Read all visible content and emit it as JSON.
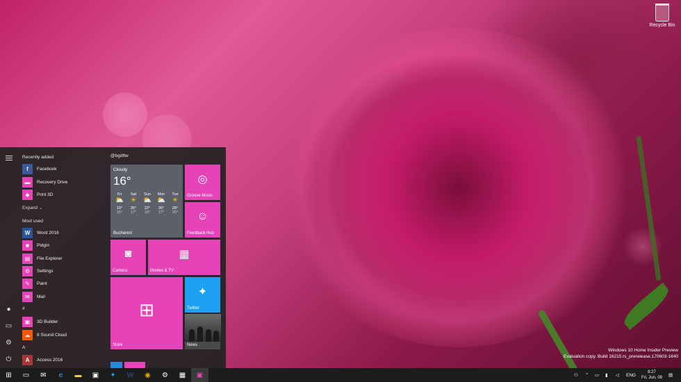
{
  "desktop": {
    "recycle_bin_label": "Recycle Bin",
    "watermark_line1": "Windows 10 Home Insider Preview",
    "watermark_line2": "Evaluation copy. Build 16215.rs_prerelease.170603-1840"
  },
  "start_menu": {
    "recently_added_label": "Recently added",
    "recent_apps": [
      {
        "label": "Facebook",
        "icon": "facebook-icon",
        "color": "#3b5998",
        "glyph": "f"
      },
      {
        "label": "Recovery Drive",
        "icon": "recovery-drive-icon",
        "color": "#e643b8",
        "glyph": "▬"
      },
      {
        "label": "Print 3D",
        "icon": "print-3d-icon",
        "color": "#e643b8",
        "glyph": "◆"
      }
    ],
    "expand_label": "Expand",
    "most_used_label": "Most used",
    "most_used_apps": [
      {
        "label": "Word 2016",
        "icon": "word-icon",
        "color": "#2b579a",
        "glyph": "W"
      },
      {
        "label": "Pidgin",
        "icon": "pidgin-icon",
        "color": "#e643b8",
        "glyph": "☻"
      },
      {
        "label": "File Explorer",
        "icon": "folder-icon",
        "color": "#e643b8",
        "glyph": "▤"
      },
      {
        "label": "Settings",
        "icon": "gear-icon",
        "color": "#e643b8",
        "glyph": "⚙"
      },
      {
        "label": "Paint",
        "icon": "paint-icon",
        "color": "#e643b8",
        "glyph": "✎"
      },
      {
        "label": "Mail",
        "icon": "mail-icon",
        "color": "#e643b8",
        "glyph": "✉"
      }
    ],
    "hash_section": "#",
    "hash_apps": [
      {
        "label": "3D Builder",
        "icon": "3d-builder-icon",
        "color": "#e643b8",
        "glyph": "▣"
      },
      {
        "label": "8 Sound Cloud",
        "icon": "soundcloud-icon",
        "color": "#ff5500",
        "glyph": "☁"
      }
    ],
    "a_section": "A",
    "a_apps": [
      {
        "label": "Access 2016",
        "icon": "access-icon",
        "color": "#a4373a",
        "glyph": "A"
      }
    ],
    "tile_group_name": "@bgdftw",
    "weather": {
      "condition": "Cloudy",
      "temperature": "16°",
      "city": "Bucharest",
      "days": [
        {
          "day": "Fri",
          "high": "19°",
          "low": "15°",
          "icon": "sun-cloud-icon"
        },
        {
          "day": "Sat",
          "high": "25°",
          "low": "17°",
          "icon": "sun-icon"
        },
        {
          "day": "Sun",
          "high": "22°",
          "low": "16°",
          "icon": "sun-cloud-icon"
        },
        {
          "day": "Mon",
          "high": "26°",
          "low": "17°",
          "icon": "sun-cloud-icon"
        },
        {
          "day": "Tue",
          "high": "28°",
          "low": "20°",
          "icon": "sun-icon"
        }
      ]
    },
    "tiles": {
      "groove_music": "Groove Music",
      "feedback_hub": "Feedback Hub",
      "camera": "Camera",
      "movies_tv": "Movies & TV",
      "store": "Store",
      "twitter": "Twitter",
      "news": "News"
    }
  },
  "taskbar": {
    "language": "ENG",
    "time": "8:27",
    "date": "Fri, Jun, 09"
  },
  "colors": {
    "accent": "#e643b8",
    "twitter": "#1da1f2",
    "taskbar": "#1c1c1c"
  }
}
